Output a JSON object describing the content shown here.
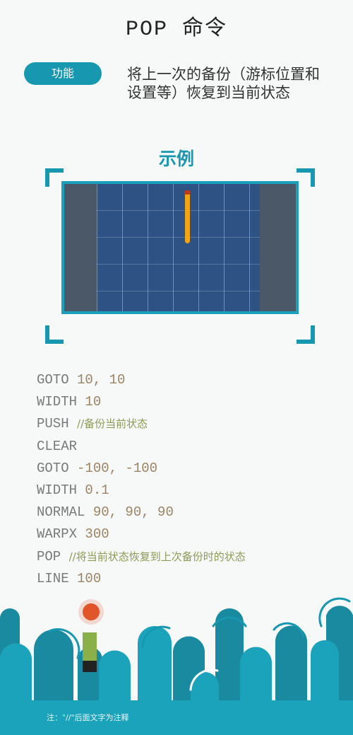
{
  "title": "POP 命令",
  "function_label": "功能",
  "function_desc": "将上一次的备份（游标位置和设置等）恢复到当前状态",
  "example_title": "示例",
  "colors": {
    "accent": "#1797b0",
    "canvas_grid": "#2d5283",
    "stroke": "#f2a412"
  },
  "code": [
    {
      "cmd": "GOTO",
      "args": "10, 10",
      "comment": ""
    },
    {
      "cmd": "WIDTH",
      "args": "10",
      "comment": ""
    },
    {
      "cmd": "PUSH",
      "args": "",
      "comment": "//备份当前状态"
    },
    {
      "cmd": "CLEAR",
      "args": "",
      "comment": ""
    },
    {
      "cmd": "GOTO",
      "args": "-100, -100",
      "comment": ""
    },
    {
      "cmd": "WIDTH",
      "args": "0.1",
      "comment": ""
    },
    {
      "cmd": "NORMAL",
      "args": "90, 90, 90",
      "comment": ""
    },
    {
      "cmd": "WARPX",
      "args": "300",
      "comment": ""
    },
    {
      "cmd": "POP",
      "args": "",
      "comment": "//将当前状态恢复到上次备份时的状态"
    },
    {
      "cmd": "LINE",
      "args": "100",
      "comment": ""
    }
  ],
  "footnote": "注：\"//\"后面文字为注释"
}
